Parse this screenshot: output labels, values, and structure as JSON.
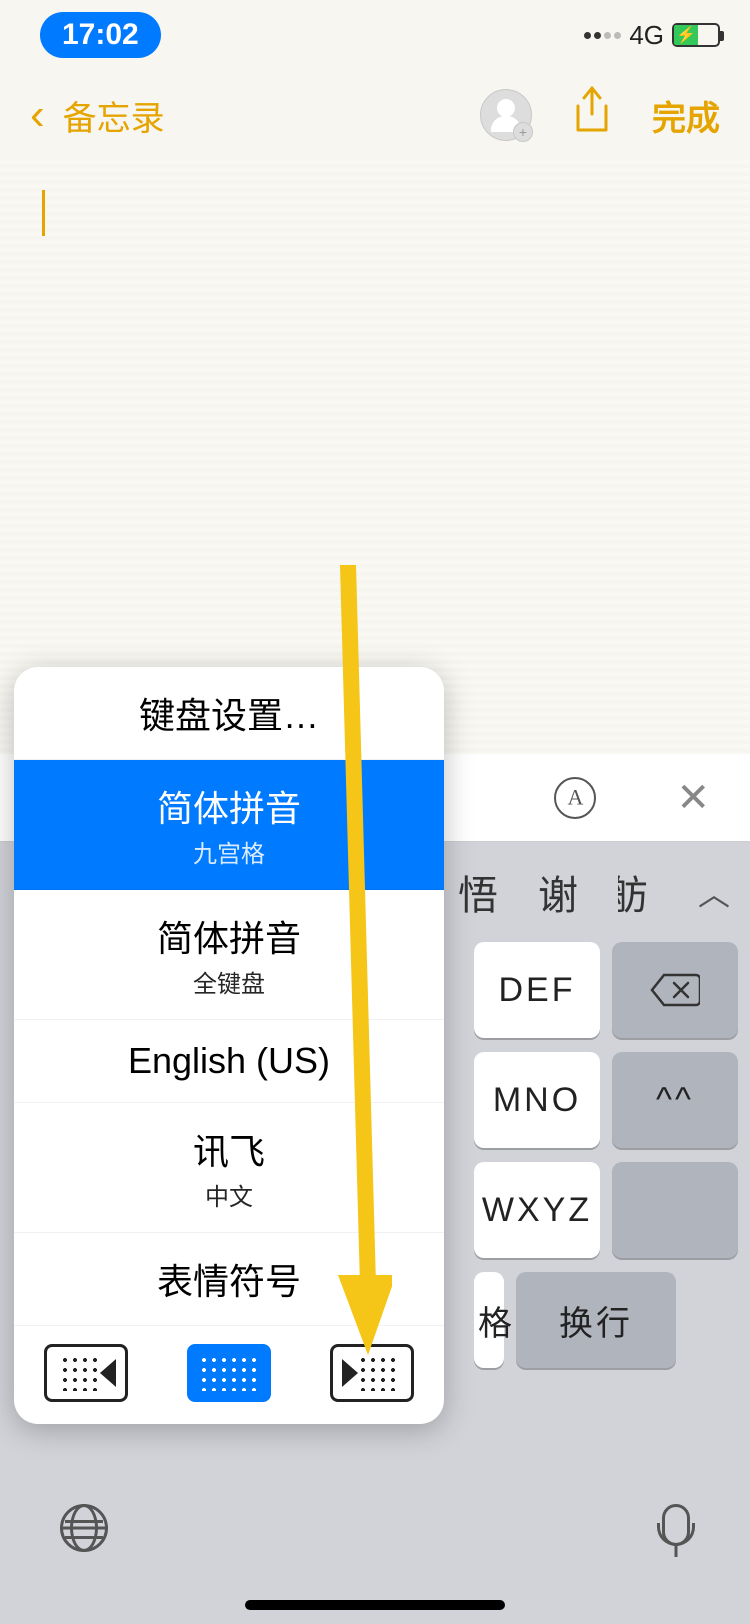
{
  "status": {
    "time": "17:02",
    "network": "4G"
  },
  "nav": {
    "back_title": "备忘录",
    "done": "完成"
  },
  "keyboard_popup": {
    "settings": "键盘设置…",
    "options": [
      {
        "main": "简体拼音",
        "sub": "九宫格",
        "selected": true
      },
      {
        "main": "简体拼音",
        "sub": "全键盘",
        "selected": false
      },
      {
        "main": "English (US)",
        "sub": "",
        "selected": false
      },
      {
        "main": "讯飞",
        "sub": "中文",
        "selected": false
      },
      {
        "main": "表情符号",
        "sub": "",
        "selected": false
      }
    ]
  },
  "candidates": {
    "c1": "悟",
    "c2": "谢",
    "c3": "舫"
  },
  "keys": {
    "def": "DEF",
    "mno": "MNO",
    "wxyz": "WXYZ",
    "emoji": "^^",
    "enter": "换行",
    "space_partial": "格"
  }
}
